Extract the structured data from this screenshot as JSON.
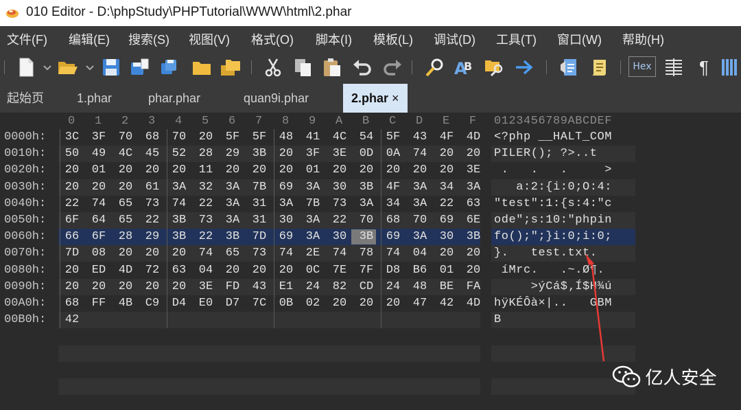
{
  "window": {
    "title": "010 Editor - D:\\phpStudy\\PHPTutorial\\WWW\\html\\2.phar"
  },
  "menu": [
    "文件(F)",
    "编辑(E)",
    "搜索(S)",
    "视图(V)",
    "格式(O)",
    "脚本(I)",
    "模板(L)",
    "调试(D)",
    "工具(T)",
    "窗口(W)",
    "帮助(H)"
  ],
  "toolbar": {
    "icons": [
      "new-file-icon",
      "open-folder-icon",
      "save-icon",
      "save-as-icon",
      "save-all-icon",
      "folder-icon",
      "folders-icon",
      "cut-icon",
      "copy-icon",
      "paste-icon",
      "undo-icon",
      "redo-icon",
      "find-icon",
      "replace-icon",
      "find-in-files-icon",
      "goto-icon",
      "template-icon",
      "script-icon",
      "hex-mode-icon",
      "columns-icon",
      "pilcrow-icon",
      "bars-icon"
    ],
    "hex_label": "Hex",
    "pilcrow": "¶"
  },
  "tabs": [
    {
      "label": "起始页",
      "active": false
    },
    {
      "label": "1.phar",
      "active": false
    },
    {
      "label": "phar.phar",
      "active": false
    },
    {
      "label": "quan9i.phar",
      "active": false
    },
    {
      "label": "2.phar",
      "active": true
    }
  ],
  "tab_close": "×",
  "editor": {
    "hex_header": [
      "0",
      "1",
      "2",
      "3",
      "4",
      "5",
      "6",
      "7",
      "8",
      "9",
      "A",
      "B",
      "C",
      "D",
      "E",
      "F"
    ],
    "ascii_header": "0123456789ABCDEF",
    "rows": [
      {
        "addr": "0000h:",
        "hex": [
          "3C",
          "3F",
          "70",
          "68",
          "70",
          "20",
          "5F",
          "5F",
          "48",
          "41",
          "4C",
          "54",
          "5F",
          "43",
          "4F",
          "4D"
        ],
        "ascii": "<?php __HALT_COM"
      },
      {
        "addr": "0010h:",
        "hex": [
          "50",
          "49",
          "4C",
          "45",
          "52",
          "28",
          "29",
          "3B",
          "20",
          "3F",
          "3E",
          "0D",
          "0A",
          "74",
          "20",
          "20"
        ],
        "ascii": "PILER(); ?>..t  "
      },
      {
        "addr": "0020h:",
        "hex": [
          "20",
          "01",
          "20",
          "20",
          "20",
          "11",
          "20",
          "20",
          "20",
          "01",
          "20",
          "20",
          "20",
          "20",
          "20",
          "3E"
        ],
        "ascii": " .   .   .     >"
      },
      {
        "addr": "0030h:",
        "hex": [
          "20",
          "20",
          "20",
          "61",
          "3A",
          "32",
          "3A",
          "7B",
          "69",
          "3A",
          "30",
          "3B",
          "4F",
          "3A",
          "34",
          "3A"
        ],
        "ascii": "   a:2:{i:0;O:4:"
      },
      {
        "addr": "0040h:",
        "hex": [
          "22",
          "74",
          "65",
          "73",
          "74",
          "22",
          "3A",
          "31",
          "3A",
          "7B",
          "73",
          "3A",
          "34",
          "3A",
          "22",
          "63"
        ],
        "ascii": "\"test\":1:{s:4:\"c"
      },
      {
        "addr": "0050h:",
        "hex": [
          "6F",
          "64",
          "65",
          "22",
          "3B",
          "73",
          "3A",
          "31",
          "30",
          "3A",
          "22",
          "70",
          "68",
          "70",
          "69",
          "6E"
        ],
        "ascii": "ode\";s:10:\"phpin"
      },
      {
        "addr": "0060h:",
        "hex": [
          "66",
          "6F",
          "28",
          "29",
          "3B",
          "22",
          "3B",
          "7D",
          "69",
          "3A",
          "30",
          "3B",
          "69",
          "3A",
          "30",
          "3B"
        ],
        "ascii": "fo();\";}i:0;i:0;"
      },
      {
        "addr": "0070h:",
        "hex": [
          "7D",
          "08",
          "20",
          "20",
          "20",
          "74",
          "65",
          "73",
          "74",
          "2E",
          "74",
          "78",
          "74",
          "04",
          "20",
          "20"
        ],
        "ascii": "}.   test.txt.  "
      },
      {
        "addr": "0080h:",
        "hex": [
          "20",
          "ED",
          "4D",
          "72",
          "63",
          "04",
          "20",
          "20",
          "20",
          "0C",
          "7E",
          "7F",
          "D8",
          "B6",
          "01",
          "20"
        ],
        "ascii": " íMrc.   .~.Ø¶. "
      },
      {
        "addr": "0090h:",
        "hex": [
          "20",
          "20",
          "20",
          "20",
          "20",
          "3E",
          "FD",
          "43",
          "E1",
          "24",
          "82",
          "CD",
          "24",
          "48",
          "BE",
          "FA"
        ],
        "ascii": "     >ýCá$‚Í$H¾ú"
      },
      {
        "addr": "00A0h:",
        "hex": [
          "68",
          "FF",
          "4B",
          "C9",
          "D4",
          "E0",
          "D7",
          "7C",
          "0B",
          "02",
          "20",
          "20",
          "20",
          "47",
          "42",
          "4D"
        ],
        "ascii": "hÿKÉÔà×|..   GBM"
      },
      {
        "addr": "00B0h:",
        "hex": [
          "42"
        ],
        "ascii": "B"
      }
    ]
  },
  "watermark": {
    "text": "亿人安全"
  }
}
